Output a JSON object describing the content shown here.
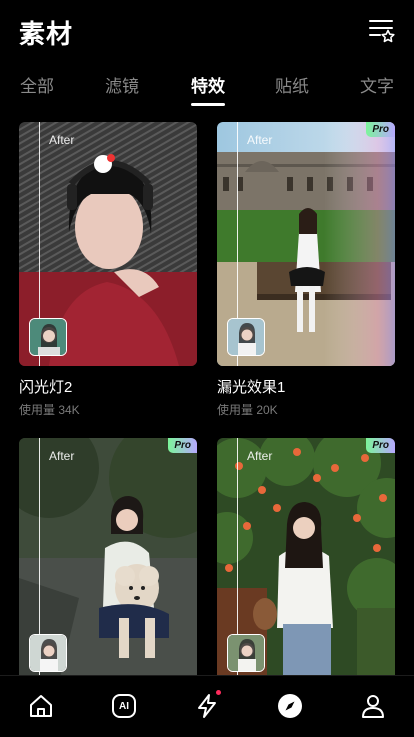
{
  "header": {
    "title": "素材"
  },
  "tabs": [
    {
      "label": "全部"
    },
    {
      "label": "滤镜"
    },
    {
      "label": "特效"
    },
    {
      "label": "贴纸"
    },
    {
      "label": "文字"
    }
  ],
  "cards": [
    {
      "name": "闪光灯2",
      "usage": "使用量 34K",
      "after_label": "After",
      "pro": ""
    },
    {
      "name": "漏光效果1",
      "usage": "使用量 20K",
      "after_label": "After",
      "pro": "Pro"
    },
    {
      "name": "",
      "usage": "",
      "after_label": "After",
      "pro": "Pro"
    },
    {
      "name": "",
      "usage": "",
      "after_label": "After",
      "pro": "Pro"
    }
  ],
  "colors": {
    "accent_dot": "#ff2b5c",
    "pro_gradient_start": "#7cf59a",
    "pro_gradient_end": "#b7a8ff"
  },
  "nav": [
    {
      "icon": "home-icon"
    },
    {
      "icon": "ai-icon",
      "label": "AI"
    },
    {
      "icon": "lightning-icon"
    },
    {
      "icon": "compass-icon"
    },
    {
      "icon": "profile-icon"
    }
  ]
}
